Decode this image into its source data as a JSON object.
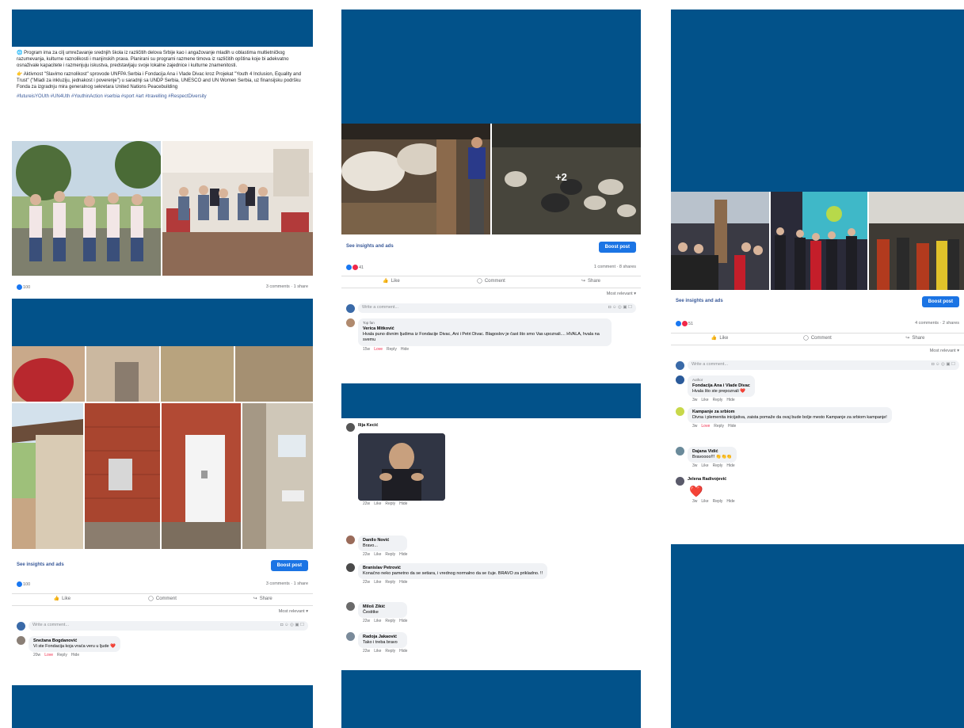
{
  "panel1": {
    "post_text_1": "🌐 Program ima za cilj umrežavanje srednjih škola iz različitih delova Srbije kao i angažovanje mladih u oblastima multietničkog razumevanja, kulturne raznolikosti i manjinskih prava. Planirani su programi razmene timova iz različitih opština koje bi adekvatno osnaživale kapacitete i razmenjuju iskustva, predstavljaju svoje lokalne zajednice i kulturne znamenitosti.",
    "post_text_2": "👉 Aktivnost \"Slavimo raznolikost\" sprovode UNFPA Serbia i Fondacija Ana i Vlade Divac kroz Projekat \"Youth 4 Inclusion, Equality and Trust\" (\"Mladi za inkluziju, jednakost i poverenje\") u saradnji sa UNDP Serbia, UNESCO and UN Women Serbia, uz finansijsku podršku Fonda za izgradnju mira generalnog sekretara United Nations Peacebuilding",
    "hashtags": "#futureisYOUth #UN4Uth #YouthinAction #serbia #sport #art #travelling #RespectDiversity",
    "likes": "100",
    "comments_shares": "3 comments · 1 share"
  },
  "panel2": {
    "see_insights": "See insights and ads",
    "boost": "Boost post",
    "likes": "100",
    "comments_shares": "3 comments · 1 share",
    "like": "Like",
    "comment": "Comment",
    "share": "Share",
    "most_relevant": "Most relevant ▾",
    "write_comment": "Write a comment...",
    "comment_name": "Snežana Bogdanović",
    "comment_text": "Vi ste Fondacija koja vraća veru u ljude ❤️",
    "time": "20w",
    "love": "Love",
    "reply": "Reply",
    "hide": "Hide"
  },
  "panel3": {
    "plus_more": "+2",
    "see_insights": "See insights and ads",
    "boost": "Boost post",
    "likes": "41",
    "comments_shares": "1 comment · 8 shares",
    "like": "Like",
    "comment": "Comment",
    "share": "Share",
    "most_relevant": "Most relevant ▾",
    "write_comment": "Write a comment...",
    "top_fan": "Top fan",
    "comment_name": "Verica Mitković",
    "comment_text": "Hvala puno divnim ljudima iz Fondacije Divac, Ani i Petri Divac. Blagoslov je čast što smo Vas upoznali.... HVALA, hvala na svemu",
    "time": "15w",
    "love": "Love",
    "reply": "Reply",
    "hide": "Hide"
  },
  "panel4": {
    "comments": [
      {
        "name": "Ilija Kecić",
        "text": "",
        "time": "22w"
      },
      {
        "name": "Danilo Nović",
        "text": "Bravo...",
        "time": "22w"
      },
      {
        "name": "Branislav Petrović",
        "text": "Konačno neko pametno da se setiara, i vrednog normalno da se čuje. BRAVO za prikladno. !!",
        "time": "22w"
      },
      {
        "name": "Miloš Zikić",
        "text": "Čestitke",
        "time": "22w"
      },
      {
        "name": "Radoja Jakaović",
        "text": "Tako i treba bravo",
        "time": "22w"
      }
    ],
    "like": "Like",
    "reply": "Reply",
    "hide": "Hide"
  },
  "panel5": {
    "see_insights": "See insights and ads",
    "boost": "Boost post",
    "likes": "51",
    "comments_shares": "4 comments · 2 shares",
    "like": "Like",
    "comment": "Comment",
    "share": "Share",
    "most_relevant": "Most relevant ▾",
    "write_comment": "Write a comment...",
    "comments": [
      {
        "name": "Fondacija Ana i Vlade Divac",
        "text": "Hvala što ste prepoznali ❤️",
        "time": "3w",
        "badge": "Author"
      },
      {
        "name": "Kampanje za srbiom",
        "text": "Divna i plemenita inicijativa, zaista pomaže da ovaj bude bolje mesto Kampanje za srbiom kampanje!",
        "time": "3w"
      },
      {
        "name": "Dajana Vidić",
        "text": "Bravoooo!!! 👏👏👏",
        "time": "3w"
      },
      {
        "name": "Jelena Radivojević",
        "text": "❤️",
        "time": "3w"
      }
    ],
    "love": "Love",
    "reply": "Reply",
    "hide": "Hide"
  },
  "colors": {
    "blue_bar": "#02528a",
    "fb_blue": "#1b74e4",
    "link": "#385898"
  }
}
